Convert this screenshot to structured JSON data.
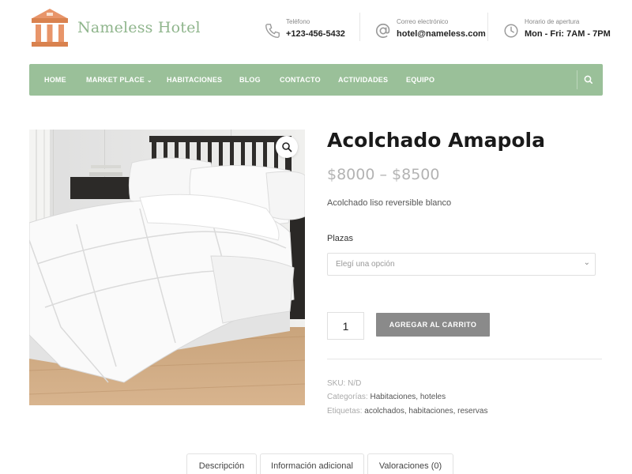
{
  "brand": {
    "name": "Nameless Hotel",
    "accent": "#9ac099",
    "logo_color": "#e8956a"
  },
  "header": {
    "phone": {
      "label": "Teléfono",
      "value": "+123-456-5432",
      "icon": "phone-icon"
    },
    "email": {
      "label": "Correo electrónico",
      "value": "hotel@nameless.com",
      "icon": "at-icon"
    },
    "hours": {
      "label": "Horario de apertura",
      "value": "Mon - Fri: 7AM - 7PM",
      "icon": "clock-icon"
    }
  },
  "nav": {
    "items": [
      {
        "label": "HOME"
      },
      {
        "label": "MARKET PLACE",
        "has_dropdown": true
      },
      {
        "label": "HABITACIONES"
      },
      {
        "label": "BLOG"
      },
      {
        "label": "CONTACTO"
      },
      {
        "label": "ACTIVIDADES"
      },
      {
        "label": "EQUIPO"
      }
    ],
    "search_icon": "search-icon"
  },
  "product": {
    "title": "Acolchado Amapola",
    "price": "$8000 – $8500",
    "short_description": "Acolchado liso reversible blanco",
    "variation": {
      "label": "Plazas",
      "placeholder": "Elegí una opción"
    },
    "quantity": "1",
    "add_to_cart": "AGREGAR AL CARRITO",
    "meta": {
      "sku_label": "SKU:",
      "sku_value": "N/D",
      "categories_label": "Categorías:",
      "categories": [
        "Habitaciones",
        "hoteles"
      ],
      "tags_label": "Etiquetas:",
      "tags": [
        "acolchados",
        "habitaciones",
        "reservas"
      ]
    }
  },
  "tabs": [
    {
      "label": "Descripción"
    },
    {
      "label": "Información adicional"
    },
    {
      "label": "Valoraciones (0)"
    }
  ]
}
